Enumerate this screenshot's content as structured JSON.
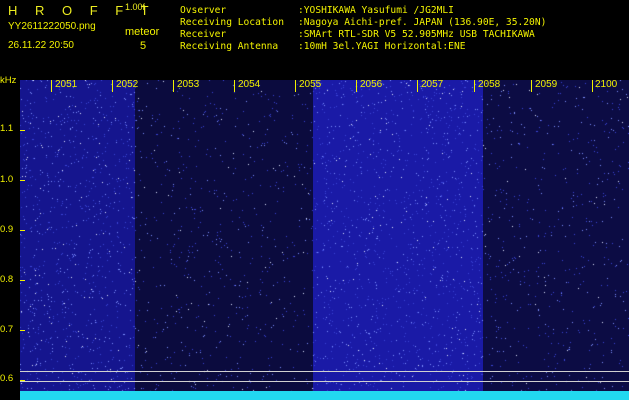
{
  "header": {
    "logo": "H R O F F T",
    "version": "1.00f",
    "filename": "YY2611222050.png",
    "datetime": "26.11.22 20:50",
    "event_kind": "meteor",
    "event_count": "5",
    "info": [
      {
        "key": "Ovserver",
        "value": ":YOSHIKAWA Yasufumi /JG2MLI"
      },
      {
        "key": "Receiving Location",
        "value": ":Nagoya Aichi-pref. JAPAN (136.90E, 35.20N)"
      },
      {
        "key": "Receiver",
        "value": ":SMArt RTL-SDR V5 52.905MHz USB TACHIKAWA"
      },
      {
        "key": "Receiving Antenna",
        "value": ":10mH 3el.YAGI Horizontal:ENE"
      }
    ]
  },
  "spectrogram": {
    "y_unit": "kHz",
    "y_ticks": [
      "1.1",
      "1.0",
      "0.9",
      "0.8",
      "0.7",
      "0.6"
    ],
    "x_ticks": [
      "2051",
      "2052",
      "2053",
      "2054",
      "2055",
      "2056",
      "2057",
      "2058",
      "2059",
      "2100"
    ],
    "colors": {
      "bright_band": "#1a1aa0",
      "dark_band": "#0a0a38",
      "dots": "#9ab0ff",
      "baseline": "#22d8f0",
      "text": "#f2f200"
    }
  }
}
